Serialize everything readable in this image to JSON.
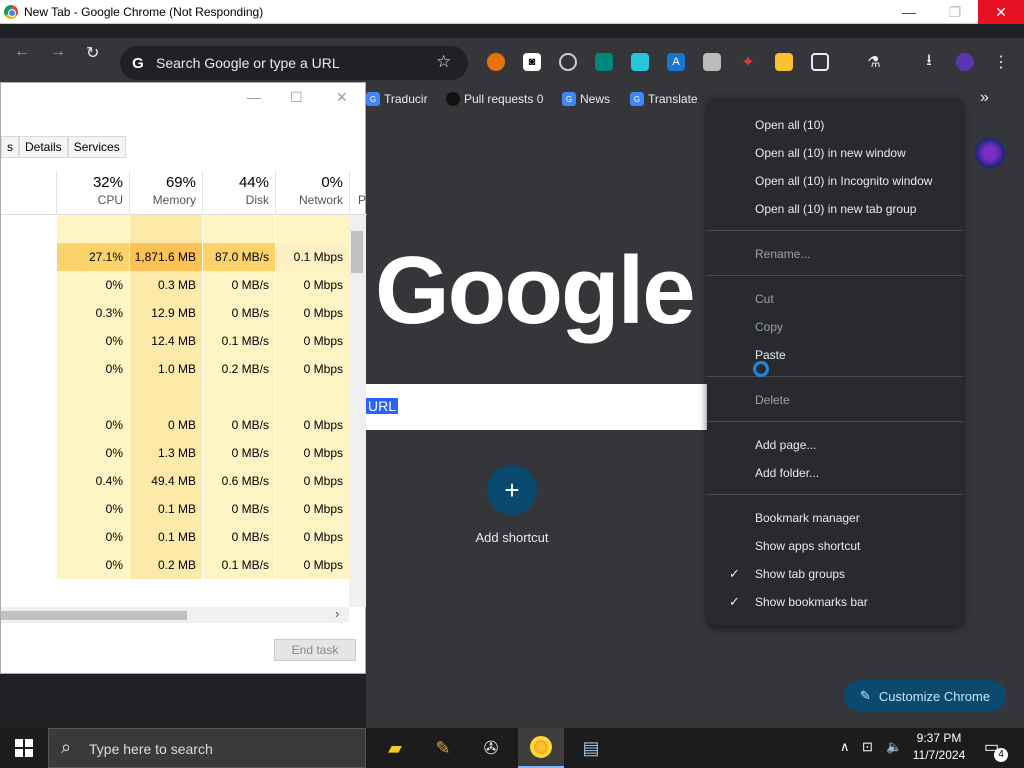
{
  "window": {
    "title": "New Tab - Google Chrome (Not Responding)",
    "minimize": "—",
    "maximize": "❐",
    "close": "✕"
  },
  "toolbar": {
    "back": "←",
    "forward": "→",
    "reload": "↻",
    "omnibox_placeholder": "Search Google or type a URL",
    "omnibox_g": "G"
  },
  "bookmarks": [
    {
      "label": "Traducir"
    },
    {
      "label": "Pull requests 0"
    },
    {
      "label": "News"
    },
    {
      "label": "Translate"
    }
  ],
  "bookmarks_more": "»",
  "newtab": {
    "logo": "Google",
    "search_selected": "URL",
    "add_shortcut": "Add shortcut",
    "add_shortcut_plus": "+",
    "customize": "Customize Chrome",
    "customize_icon": "✎"
  },
  "task_manager": {
    "tabs": [
      "s",
      "Details",
      "Services"
    ],
    "columns": [
      {
        "pct": "32%",
        "label": "CPU"
      },
      {
        "pct": "69%",
        "label": "Memory"
      },
      {
        "pct": "44%",
        "label": "Disk"
      },
      {
        "pct": "0%",
        "label": "Network"
      },
      {
        "pct": "",
        "label": "P"
      }
    ],
    "rows": [
      [
        "",
        "",
        "",
        ""
      ],
      [
        "27.1%",
        "1,871.6 MB",
        "87.0 MB/s",
        "0.1 Mbps"
      ],
      [
        "0%",
        "0.3 MB",
        "0 MB/s",
        "0 Mbps"
      ],
      [
        "0.3%",
        "12.9 MB",
        "0 MB/s",
        "0 Mbps"
      ],
      [
        "0%",
        "12.4 MB",
        "0.1 MB/s",
        "0 Mbps"
      ],
      [
        "0%",
        "1.0 MB",
        "0.2 MB/s",
        "0 Mbps"
      ],
      [
        "",
        "",
        "",
        ""
      ],
      [
        "0%",
        "0 MB",
        "0 MB/s",
        "0 Mbps"
      ],
      [
        "0%",
        "1.3 MB",
        "0 MB/s",
        "0 Mbps"
      ],
      [
        "0.4%",
        "49.4 MB",
        "0.6 MB/s",
        "0 Mbps"
      ],
      [
        "0%",
        "0.1 MB",
        "0 MB/s",
        "0 Mbps"
      ],
      [
        "0%",
        "0.1 MB",
        "0 MB/s",
        "0 Mbps"
      ],
      [
        "0%",
        "0.2 MB",
        "0.1 MB/s",
        "0 Mbps"
      ]
    ],
    "end_task": "End task",
    "scroll_right": "›"
  },
  "context_menu": {
    "group1": [
      "Open all (10)",
      "Open all (10) in new window",
      "Open all (10) in Incognito window",
      "Open all (10) in new tab group"
    ],
    "rename": "Rename...",
    "cut": "Cut",
    "copy": "Copy",
    "paste": "Paste",
    "delete": "Delete",
    "add_page": "Add page...",
    "add_folder": "Add folder...",
    "bookmark_manager": "Bookmark manager",
    "show_apps": "Show apps shortcut",
    "show_tab_groups": "Show tab groups",
    "show_bookmarks_bar": "Show bookmarks bar",
    "checkmark": "✓"
  },
  "taskbar": {
    "search_placeholder": "Type here to search",
    "time": "9:37 PM",
    "date": "11/7/2024",
    "notification_count": "4"
  }
}
